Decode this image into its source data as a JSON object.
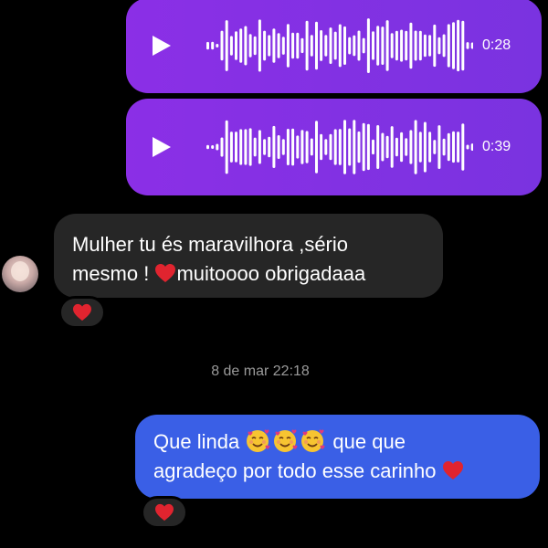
{
  "messages": {
    "voice_1": {
      "duration": "0:28",
      "icon": "play-icon"
    },
    "voice_2": {
      "duration": "0:39",
      "icon": "play-icon"
    },
    "incoming": {
      "line1": "Mulher tu és maravilhora ,sério",
      "line2_start": "mesmo ! ",
      "line2_end": "muitoooo obrigadaaa",
      "reaction": "heart-icon"
    },
    "timestamp": "8 de mar 22:18",
    "outgoing": {
      "line1_start": "Que linda ",
      "line1_end": " que que",
      "line2": "agradeço por todo esse carinho ",
      "emoji": "smiling-face-with-hearts-icon",
      "reaction": "heart-icon"
    }
  },
  "colors": {
    "background": "#000000",
    "voice_bubble": "#8b2fe6",
    "incoming_bubble": "#262626",
    "outgoing_bubble": "#3a5fe6",
    "heart": "#e0242f",
    "timestamp": "#9a9a9a"
  }
}
